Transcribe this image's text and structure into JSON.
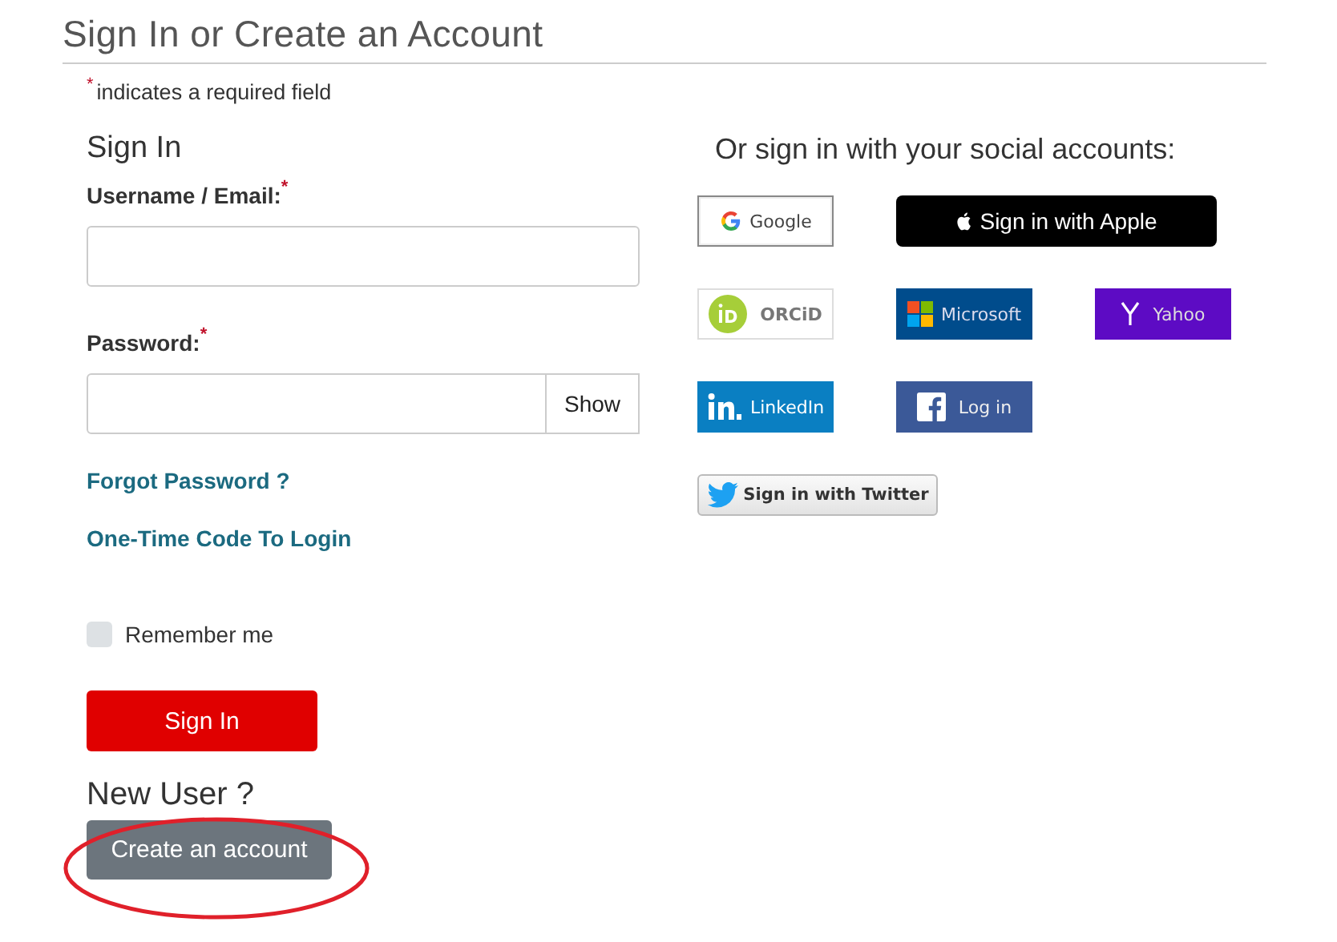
{
  "page_title": "Sign In or Create an Account",
  "required_note": {
    "mark": "*",
    "text": "indicates a required field"
  },
  "sign_in": {
    "heading": "Sign In",
    "fields": [
      {
        "kind": "text",
        "label": "Username / Email:",
        "required_mark": "*"
      },
      {
        "kind": "password",
        "label": "Password:",
        "required_mark": "*",
        "toggle": "Show"
      }
    ],
    "links": [
      "Forgot Password ?",
      "One-Time Code To Login"
    ],
    "remember": {
      "label": "Remember me",
      "checked": false
    },
    "submit": "Sign In"
  },
  "new_user": {
    "heading": "New User ?",
    "button": "Create an account",
    "circled": true
  },
  "social": {
    "heading": "Or sign in with your social accounts:",
    "providers": [
      {
        "kind": "google",
        "label": "Google"
      },
      {
        "kind": "apple",
        "label": "Sign in with Apple"
      },
      {
        "kind": "orcid",
        "label": "ORCiD"
      },
      {
        "kind": "microsoft",
        "label": "Microsoft"
      },
      {
        "kind": "yahoo",
        "label": "Yahoo"
      },
      {
        "kind": "linkedin",
        "label": "LinkedIn"
      },
      {
        "kind": "facebook",
        "label": "Log in"
      },
      {
        "kind": "twitter",
        "label": "Sign in with Twitter"
      }
    ]
  }
}
